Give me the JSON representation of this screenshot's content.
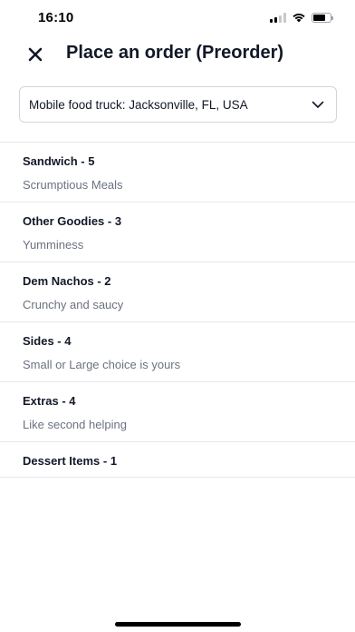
{
  "status_bar": {
    "time": "16:10",
    "icons": [
      "cellular-signal-icon",
      "wifi-icon",
      "battery-icon"
    ],
    "battery_level": 0.7
  },
  "header": {
    "close_icon": "close-icon",
    "title": "Place an order (Preorder)"
  },
  "location": {
    "selected": "Mobile food truck: Jacksonville, FL, USA",
    "icon": "chevron-down-icon"
  },
  "categories": [
    {
      "name": "Sandwich - 5",
      "description": "Scrumptious Meals"
    },
    {
      "name": "Other Goodies - 3",
      "description": "Yumminess"
    },
    {
      "name": "Dem Nachos - 2",
      "description": "Crunchy and saucy"
    },
    {
      "name": "Sides - 4",
      "description": "Small or Large choice is yours"
    },
    {
      "name": "Extras - 4",
      "description": "Like second helping"
    },
    {
      "name": "Dessert Items - 1",
      "description": ""
    }
  ],
  "colors": {
    "text_primary": "#111827",
    "text_secondary": "#6b7280",
    "divider": "#e5e7eb",
    "border": "#d1d5db"
  }
}
